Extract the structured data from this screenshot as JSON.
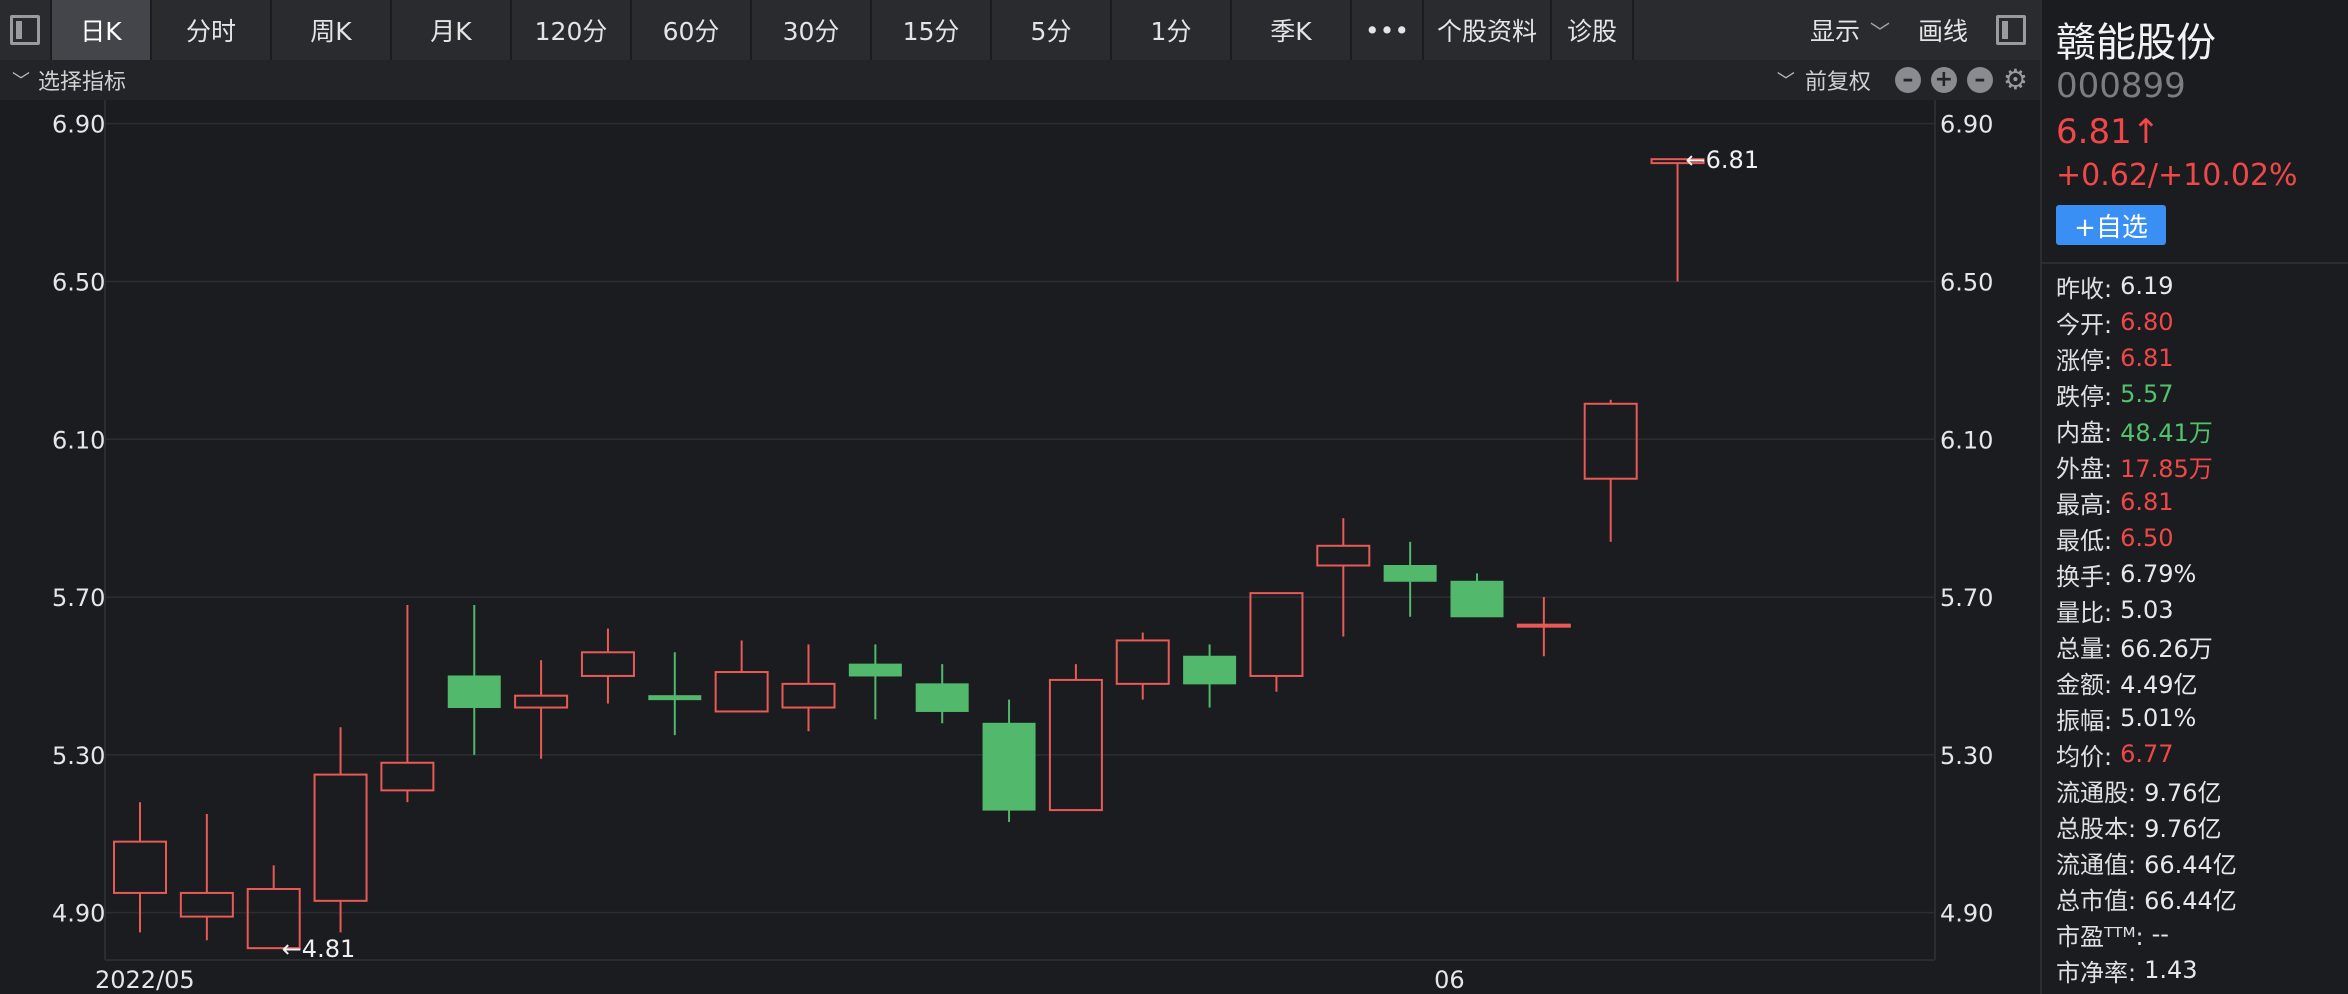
{
  "toolbar": {
    "tabs": [
      {
        "label": "日K",
        "active": true
      },
      {
        "label": "分时"
      },
      {
        "label": "周K"
      },
      {
        "label": "月K"
      },
      {
        "label": "120分"
      },
      {
        "label": "60分"
      },
      {
        "label": "30分"
      },
      {
        "label": "15分"
      },
      {
        "label": "5分"
      },
      {
        "label": "1分"
      },
      {
        "label": "季K"
      }
    ],
    "more_label": "•••",
    "profile_label": "个股资料",
    "diagnose_label": "诊股",
    "display_label": "显示",
    "draw_label": "画线"
  },
  "subbar": {
    "indicator_label": "选择指标",
    "adjust_label": "前复权"
  },
  "colors": {
    "up": "#e85a55",
    "down": "#52b86b",
    "grid": "#2c2d32",
    "axis_text": "#e6e6e6"
  },
  "chart_data": {
    "type": "candlestick",
    "ylim": [
      4.78,
      6.96
    ],
    "yticks": [
      "6.90",
      "6.50",
      "6.10",
      "5.70",
      "5.30",
      "4.90"
    ],
    "x_labels": [
      {
        "index": 0,
        "text": "2022/05"
      },
      {
        "index": 19,
        "text": "06"
      }
    ],
    "max_marker": {
      "index": 23,
      "text": "6.81"
    },
    "min_marker": {
      "index": 2,
      "text": "4.81"
    },
    "candles": [
      {
        "o": 4.95,
        "h": 5.18,
        "l": 4.85,
        "c": 5.08
      },
      {
        "o": 4.89,
        "h": 5.15,
        "l": 4.83,
        "c": 4.95
      },
      {
        "o": 4.81,
        "h": 5.02,
        "l": 4.81,
        "c": 4.96
      },
      {
        "o": 4.93,
        "h": 5.37,
        "l": 4.85,
        "c": 5.25
      },
      {
        "o": 5.21,
        "h": 5.68,
        "l": 5.18,
        "c": 5.28
      },
      {
        "o": 5.5,
        "h": 5.68,
        "l": 5.3,
        "c": 5.42
      },
      {
        "o": 5.42,
        "h": 5.54,
        "l": 5.29,
        "c": 5.45
      },
      {
        "o": 5.5,
        "h": 5.62,
        "l": 5.43,
        "c": 5.56
      },
      {
        "o": 5.45,
        "h": 5.56,
        "l": 5.35,
        "c": 5.44
      },
      {
        "o": 5.41,
        "h": 5.59,
        "l": 5.41,
        "c": 5.51
      },
      {
        "o": 5.42,
        "h": 5.58,
        "l": 5.36,
        "c": 5.48
      },
      {
        "o": 5.53,
        "h": 5.58,
        "l": 5.39,
        "c": 5.5
      },
      {
        "o": 5.48,
        "h": 5.53,
        "l": 5.38,
        "c": 5.41
      },
      {
        "o": 5.38,
        "h": 5.44,
        "l": 5.13,
        "c": 5.16
      },
      {
        "o": 5.16,
        "h": 5.53,
        "l": 5.16,
        "c": 5.49
      },
      {
        "o": 5.48,
        "h": 5.61,
        "l": 5.44,
        "c": 5.59
      },
      {
        "o": 5.55,
        "h": 5.58,
        "l": 5.42,
        "c": 5.48
      },
      {
        "o": 5.5,
        "h": 5.71,
        "l": 5.46,
        "c": 5.71
      },
      {
        "o": 5.78,
        "h": 5.9,
        "l": 5.6,
        "c": 5.83
      },
      {
        "o": 5.78,
        "h": 5.84,
        "l": 5.65,
        "c": 5.74
      },
      {
        "o": 5.74,
        "h": 5.76,
        "l": 5.65,
        "c": 5.65
      },
      {
        "o": 5.63,
        "h": 5.7,
        "l": 5.55,
        "c": 5.63
      },
      {
        "o": 6.0,
        "h": 6.2,
        "l": 5.84,
        "c": 6.19
      },
      {
        "o": 6.8,
        "h": 6.81,
        "l": 6.5,
        "c": 6.81
      }
    ]
  },
  "panel": {
    "name": "赣能股份",
    "code": "000899",
    "price": "6.81↑",
    "change": "+0.62/+10.02%",
    "add_label": "+自选",
    "stats": [
      {
        "k": "昨收:",
        "v": "6.19",
        "color": "white"
      },
      {
        "k": "今开:",
        "v": "6.80",
        "color": "red"
      },
      {
        "k": "涨停:",
        "v": "6.81",
        "color": "red"
      },
      {
        "k": "跌停:",
        "v": "5.57",
        "color": "green"
      },
      {
        "k": "内盘:",
        "v": "48.41万",
        "color": "green"
      },
      {
        "k": "外盘:",
        "v": "17.85万",
        "color": "red"
      },
      {
        "k": "最高:",
        "v": "6.81",
        "color": "red"
      },
      {
        "k": "最低:",
        "v": "6.50",
        "color": "red"
      },
      {
        "k": "换手:",
        "v": "6.79%",
        "color": "white"
      },
      {
        "k": "量比:",
        "v": "5.03",
        "color": "white"
      },
      {
        "k": "总量:",
        "v": "66.26万",
        "color": "white"
      },
      {
        "k": "金额:",
        "v": "4.49亿",
        "color": "white"
      },
      {
        "k": "振幅:",
        "v": "5.01%",
        "color": "white"
      },
      {
        "k": "均价:",
        "v": "6.77",
        "color": "red"
      },
      {
        "k": "流通股:",
        "v": "9.76亿",
        "color": "white"
      },
      {
        "k": "总股本:",
        "v": "9.76亿",
        "color": "white"
      },
      {
        "k": "流通值:",
        "v": "66.44亿",
        "color": "white"
      },
      {
        "k": "总市值:",
        "v": "66.44亿",
        "color": "white"
      },
      {
        "k": "市盈ᵀᵀᴹ:",
        "v": "--",
        "color": "white"
      },
      {
        "k": "市净率:",
        "v": "1.43",
        "color": "white"
      }
    ]
  }
}
